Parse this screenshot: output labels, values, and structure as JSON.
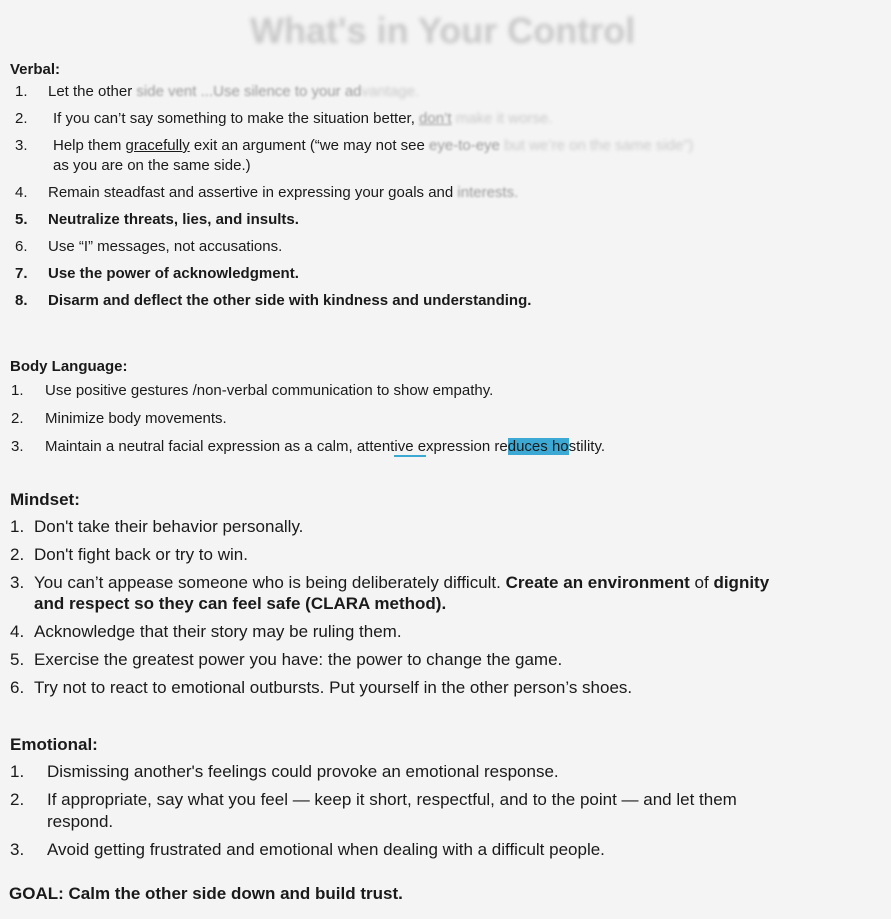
{
  "title": "What's in Your Control",
  "verbal": {
    "heading": "Verbal:",
    "items": [
      {
        "num": "1.",
        "a": "Let the other ",
        "b": "side vent ...Use silence to your ad",
        "c": "vantage."
      },
      {
        "num": "2.",
        "a": "If you can’t say something to make the situation better, ",
        "b": "don’t",
        "c": " make it worse."
      },
      {
        "num": "3.",
        "a": "Help them ",
        "u": "gracefully",
        "a2": " exit an argument (“we may not see ",
        "b": "eye-to-eye",
        "c": " but we’re on the same side”)",
        "a3": "as you are on the same side.)"
      },
      {
        "num": "4.",
        "a": "Remain steadfast and assertive in expressing your goals and ",
        "b": "interests."
      },
      {
        "num": "5.",
        "a": "Neutralize threats, lies, and insults."
      },
      {
        "num": "6.",
        "a": "Use “I” messages, not accusations."
      },
      {
        "num": "7.",
        "a": "Use the power of acknowledgment."
      },
      {
        "num": "8.",
        "a": "Disarm and deflect the other side with kindness and understanding."
      }
    ]
  },
  "body_language": {
    "heading": "Body Language:",
    "items": [
      {
        "num": "1.",
        "text": "Use positive gestures /non-verbal communication to show empathy."
      },
      {
        "num": "2.",
        "text": "Minimize body movements."
      },
      {
        "num": "3.",
        "a": "Maintain a neutral facial expression as a calm, attent",
        "ul": "ive e",
        "b": "xpression re",
        "hl": "duces ho",
        "c": "stility."
      }
    ]
  },
  "mindset": {
    "heading": "Mindset:",
    "items": [
      {
        "num": "1.",
        "text": "Don't take their behavior personally."
      },
      {
        "num": "2.",
        "text": "Don't fight back or try to win."
      },
      {
        "num": "3.",
        "a": "You can’t appease someone who is being deliberately difficult. ",
        "b1": "Create an environment",
        "a2": " of ",
        "b2": "dignity",
        "b3": "and respect so they can feel safe (CLARA method)."
      },
      {
        "num": "4.",
        "text": "Acknowledge that their story may be ruling them."
      },
      {
        "num": "5.",
        "text": "Exercise the greatest power you have: the power to change the game."
      },
      {
        "num": "6.",
        "text": "Try not to react to emotional outbursts. Put yourself in the other person’s shoes."
      }
    ]
  },
  "emotional": {
    "heading": "Emotional:",
    "items": [
      {
        "num": "1.",
        "text": "Dismissing another's feelings could provoke an emotional response."
      },
      {
        "num": "2.",
        "line1": "If appropriate, say what you feel  — keep it short, respectful, and to the point — and let them",
        "line2": "respond."
      },
      {
        "num": "3.",
        "text": "Avoid getting frustrated and emotional when dealing with a difficult people."
      }
    ]
  },
  "goal": "GOAL: Calm the other side down and build trust."
}
